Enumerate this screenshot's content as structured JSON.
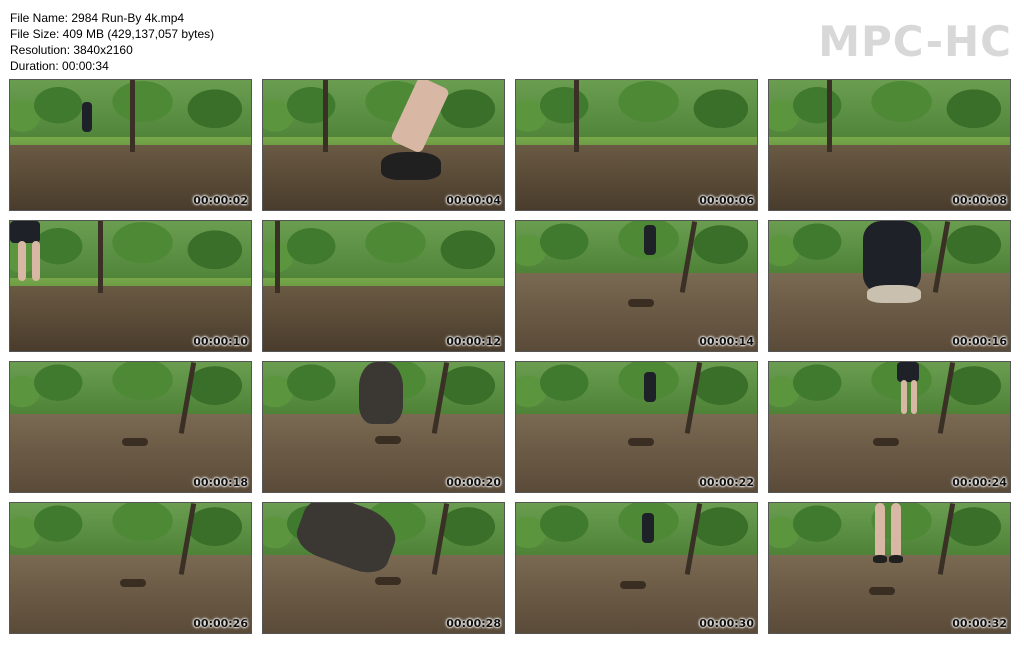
{
  "info": {
    "file_name": "File Name: 2984 Run-By 4k.mp4",
    "file_size": "File Size: 409 MB (429,137,057 bytes)",
    "resolution": "Resolution: 3840x2160",
    "duration": "Duration: 00:00:34"
  },
  "logo": "MPC-HC",
  "thumbnails": [
    {
      "time": "00:00:02"
    },
    {
      "time": "00:00:04"
    },
    {
      "time": "00:00:06"
    },
    {
      "time": "00:00:08"
    },
    {
      "time": "00:00:10"
    },
    {
      "time": "00:00:12"
    },
    {
      "time": "00:00:14"
    },
    {
      "time": "00:00:16"
    },
    {
      "time": "00:00:18"
    },
    {
      "time": "00:00:20"
    },
    {
      "time": "00:00:22"
    },
    {
      "time": "00:00:24"
    },
    {
      "time": "00:00:26"
    },
    {
      "time": "00:00:28"
    },
    {
      "time": "00:00:30"
    },
    {
      "time": "00:00:32"
    }
  ]
}
